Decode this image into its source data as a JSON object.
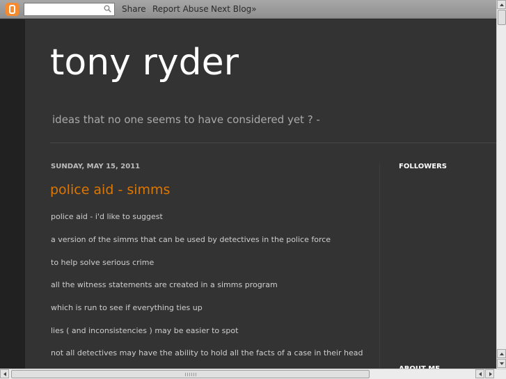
{
  "navbar": {
    "search_placeholder": "",
    "share_label": "Share",
    "report_label": "Report Abuse",
    "next_label": "Next Blog»"
  },
  "header": {
    "title": "tony ryder",
    "description": "ideas that no one seems to have considered yet ? -"
  },
  "post": {
    "date": "SUNDAY, MAY 15, 2011",
    "title": "police aid - simms",
    "lines": [
      "police aid - i'd like to suggest",
      "a version of the simms that can be used by detectives in the police force",
      "to help solve serious crime",
      "all the witness statements are created in a simms program",
      "which is run to see if everything ties up",
      "lies ( and inconsistencies ) may be easier to spot",
      "not all detectives may have the ability to hold all the facts of a case in their head"
    ]
  },
  "sidebar": {
    "followers_title": "FOLLOWERS",
    "about_title": "ABOUT ME"
  },
  "colors": {
    "background": "#333333",
    "title": "#ffffff",
    "post_title": "#dd7700",
    "navbar": "#999999",
    "blogger_logo": "#f58a2e"
  },
  "icons": {
    "logo": "blogger-logo-icon",
    "search": "search-icon"
  }
}
